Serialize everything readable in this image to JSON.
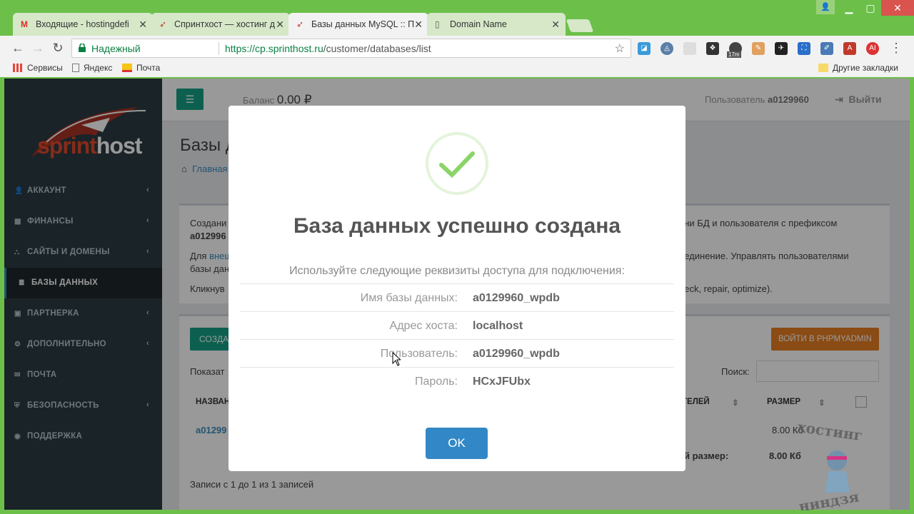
{
  "browser": {
    "tabs": [
      {
        "title": "Входящие - hostingdefi",
        "icon": "gmail-icon"
      },
      {
        "title": "Спринтхост — хостинг д",
        "icon": "sprinthost-icon"
      },
      {
        "title": "Базы данных MySQL :: П",
        "icon": "sprinthost-icon",
        "active": true
      },
      {
        "title": "Domain Name",
        "icon": "page-icon"
      }
    ],
    "address": {
      "secure_label": "Надежный",
      "url_host": "https://cp.sprinthost.ru",
      "url_path": "/customer/databases/list"
    },
    "ext_badge": "17m",
    "bookmarks": [
      "Сервисы",
      "Яндекс",
      "Почта"
    ],
    "other_bookmarks": "Другие закладки"
  },
  "sidebar": {
    "logo_sprint": "sprint",
    "logo_host": "host",
    "items": [
      {
        "label": "АККАУНТ"
      },
      {
        "label": "ФИНАНСЫ"
      },
      {
        "label": "САЙТЫ И ДОМЕНЫ"
      },
      {
        "label": "БАЗЫ ДАННЫХ",
        "active": true
      },
      {
        "label": "ПАРТНЕРКА"
      },
      {
        "label": "ДОПОЛНИТЕЛЬНО"
      },
      {
        "label": "ПОЧТА"
      },
      {
        "label": "БЕЗОПАСНОСТЬ"
      },
      {
        "label": "ПОДДЕРЖКА"
      }
    ]
  },
  "topbar": {
    "balance_label": "Баланс",
    "balance_value": "0.00 ₽",
    "user_label": "Пользователь",
    "user_name": "a0129960",
    "logout_label": "Выйти"
  },
  "content": {
    "title": "Базы д",
    "breadcrumb": "Главная",
    "info_lines": [
      "Создани",
      "a012996",
      "Для",
      "внеш",
      "базы дан",
      "Кликнув"
    ],
    "info_right": [
      "ени БД и пользователя с префиксом",
      "оединение. Управлять пользователями",
      "heck, repair, optimize)."
    ],
    "create_label": "СОЗДА",
    "pma_label": "ВОЙТИ В PHPMYADMIN",
    "show_label": "Показат",
    "search_label": "Поиск:",
    "col_name": "НАЗВАН",
    "col_users": "ТЕЛЕЙ",
    "col_size": "РАЗМЕР",
    "row_name": "a01299",
    "row_size": "8.00 Кб",
    "total_label": "й размер:",
    "total_value": "8.00 Кб",
    "records": "Записи с 1 до 1 из 1 записей"
  },
  "modal": {
    "title": "База данных успешно создана",
    "subtitle": "Используйте следующие реквизиты доступа для подключения:",
    "rows": [
      {
        "label": "Имя базы данных:",
        "value": "a0129960_wpdb"
      },
      {
        "label": "Адрес хоста:",
        "value": "localhost"
      },
      {
        "label": "Пользователь:",
        "value": "a0129960_wpdb"
      },
      {
        "label": "Пароль:",
        "value": "HCxJFUbx"
      }
    ],
    "ok_label": "OK"
  },
  "watermark": {
    "top": "хостинг",
    "bottom": "ниндзя"
  }
}
